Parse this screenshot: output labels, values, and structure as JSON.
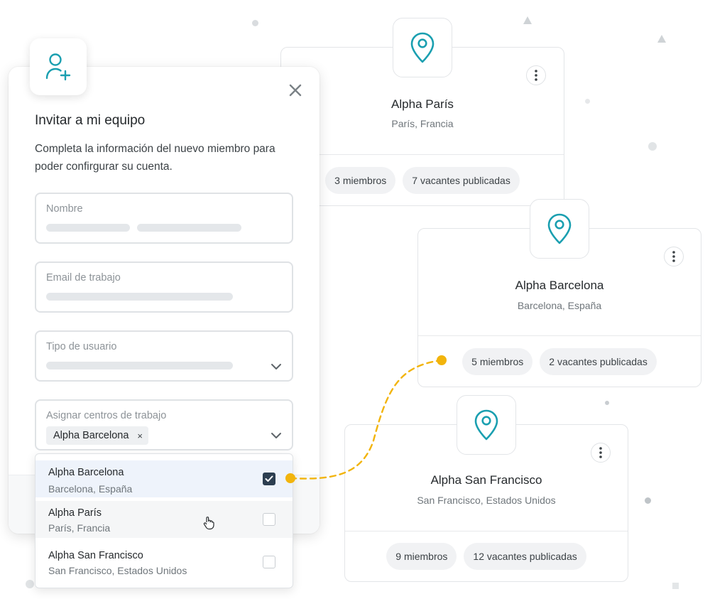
{
  "modal": {
    "title": "Invitar a mi equipo",
    "description": "Completa la información del nuevo miembro para poder confirgurar su cuenta.",
    "fields": {
      "name_label": "Nombre",
      "email_label": "Email de trabajo",
      "user_type_label": "Tipo de usuario",
      "workcenters_label": "Asignar centros de trabajo"
    },
    "selected_tag": {
      "label": "Alpha Barcelona",
      "remove": "×"
    },
    "options": [
      {
        "name": "Alpha Barcelona",
        "location": "Barcelona, España",
        "checked": true
      },
      {
        "name": "Alpha París",
        "location": "París, Francia",
        "checked": false
      },
      {
        "name": "Alpha San Francisco",
        "location": "San Francisco, Estados Unidos",
        "checked": false
      }
    ]
  },
  "cards": [
    {
      "name": "Alpha París",
      "location": "París, Francia",
      "members": "3 miembros",
      "vacancies": "7 vacantes publicadas"
    },
    {
      "name": "Alpha Barcelona",
      "location": "Barcelona, España",
      "members": "5 miembros",
      "vacancies": "2 vacantes publicadas"
    },
    {
      "name": "Alpha San Francisco",
      "location": "San Francisco, Estados Unidos",
      "members": "9 miembros",
      "vacancies": "12 vacantes publicadas"
    }
  ],
  "colors": {
    "teal_icon": "#1a9fb0",
    "connector": "#f2b40c",
    "checkbox_checked": "#2c3e50"
  },
  "icons": [
    "add-user-icon",
    "close-icon",
    "map-pin-icon",
    "kebab-menu-icon",
    "chevron-down-icon",
    "hand-cursor-icon",
    "checkmark-icon"
  ]
}
